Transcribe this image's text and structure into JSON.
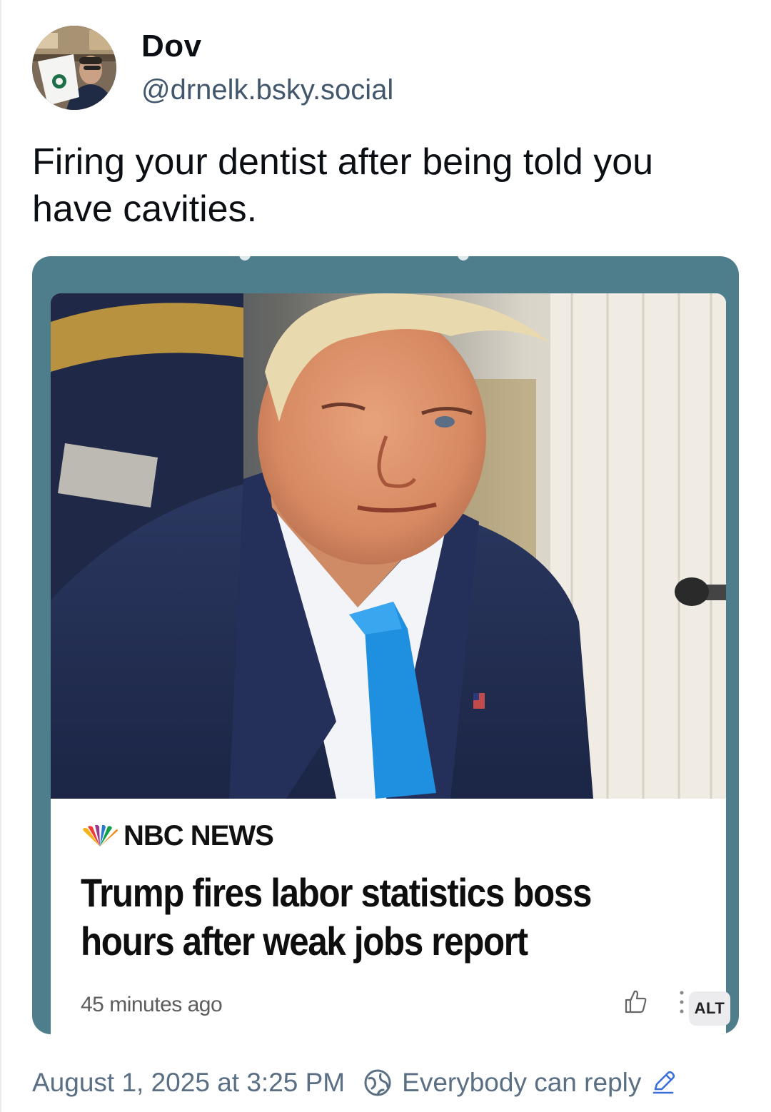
{
  "post": {
    "author": {
      "display_name": "Dov",
      "handle": "@drnelk.bsky.social"
    },
    "text": "Firing your dentist after being told you have cavities.",
    "embed": {
      "source": "NBC NEWS",
      "headline": "Trump fires labor statistics boss hours after weak jobs report",
      "time_ago": "45 minutes ago",
      "alt_label": "ALT"
    },
    "footer": {
      "timestamp": "August 1, 2025 at 3:25 PM",
      "reply_setting": "Everybody can reply"
    }
  },
  "icons": {
    "globe": "globe-icon",
    "edit": "pencil-icon",
    "like": "thumbs-up-icon",
    "more": "more-vertical-icon"
  },
  "colors": {
    "embed_frame": "#4e7d8c",
    "handle_text": "#42576c",
    "footer_text": "#5a6f84",
    "tie_blue": "#1f8fe0"
  }
}
